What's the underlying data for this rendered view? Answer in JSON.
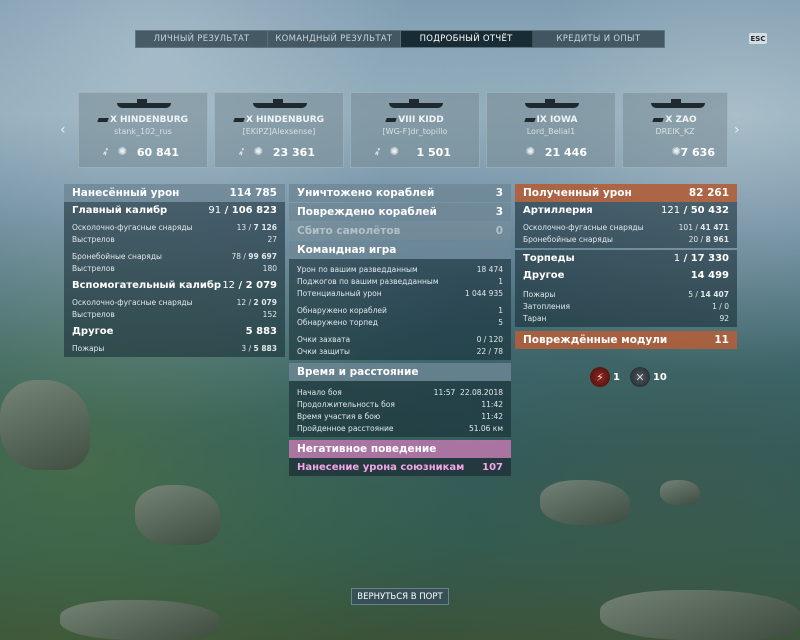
{
  "tabs": [
    "ЛИЧНЫЙ РЕЗУЛЬТАТ",
    "КОМАНДНЫЙ РЕЗУЛЬТАТ",
    "ПОДРОБНЫЙ ОТЧЁТ",
    "КРЕДИТЫ И ОПЫТ"
  ],
  "active_tab": "ПОДРОБНЫЙ ОТЧЁТ",
  "esc_label": "ESC",
  "ships": [
    {
      "name": "X HINDENBURG",
      "player": "stank_102_rus",
      "damage": "60 841"
    },
    {
      "name": "X HINDENBURG",
      "player": "[EKIPZ]Alexsense]",
      "damage": "23 361"
    },
    {
      "name": "VIII KIDD",
      "player": "[WG-F]dr_topillo",
      "damage": "1 501"
    },
    {
      "name": "IX IOWA",
      "player": "Lord_Belial1",
      "damage": "21 446"
    },
    {
      "name": "X ZAO",
      "player": "DREIK_KZ",
      "damage": "7 636"
    }
  ],
  "left": {
    "dealt": {
      "label": "Нанесённый урон",
      "value": "114 785"
    },
    "main": {
      "label": "Главный калибр",
      "hits": "91",
      "total": "106 823"
    },
    "main_rows": [
      {
        "label": "Осколочно-фугасные снаряды",
        "hits": "13",
        "total": "7 126"
      },
      {
        "label": "Выстрелов",
        "value": "27"
      },
      {
        "label": "Бронебойные снаряды",
        "hits": "78",
        "total": "99 697"
      },
      {
        "label": "Выстрелов",
        "value": "180"
      }
    ],
    "secondary": {
      "label": "Вспомогательный калибр",
      "hits": "12",
      "total": "2 079"
    },
    "secondary_rows": [
      {
        "label": "Осколочно-фугасные снаряды",
        "hits": "12",
        "total": "2 079"
      },
      {
        "label": "Выстрелов",
        "value": "152"
      }
    ],
    "other": {
      "label": "Другое",
      "value": "5 883"
    },
    "other_rows": [
      {
        "label": "Пожары",
        "hits": "3",
        "total": "5 883"
      }
    ]
  },
  "mid": {
    "destroyed": {
      "label": "Уничтожено кораблей",
      "value": "3"
    },
    "damaged": {
      "label": "Повреждено кораблей",
      "value": "3"
    },
    "planes": {
      "label": "Сбито самолётов",
      "value": "0"
    },
    "team": {
      "label": "Командная игра"
    },
    "team_rows": [
      {
        "label": "Урон по вашим разведданным",
        "value": "18 474"
      },
      {
        "label": "Поджогов по вашим разведданным",
        "value": "1"
      },
      {
        "label": "Потенциальный урон",
        "value": "1 044 935"
      },
      {
        "label": "Обнаружено кораблей",
        "value": "1"
      },
      {
        "label": "Обнаружено торпед",
        "value": "5"
      },
      {
        "label": "Очки захвата",
        "value": "0 / 120"
      },
      {
        "label": "Очки защиты",
        "value": "22 / 78"
      }
    ],
    "time": {
      "label": "Время и расстояние"
    },
    "time_rows": [
      {
        "label": "Начало боя",
        "value": "11:57  22.08.2018"
      },
      {
        "label": "Продолжительность боя",
        "value": "11:42"
      },
      {
        "label": "Время участия в бою",
        "value": "11:42"
      },
      {
        "label": "Пройденное расстояние",
        "value": "51.06 км"
      }
    ],
    "negative": {
      "label": "Негативное поведение"
    },
    "ally_damage": {
      "label": "Нанесение урона союзникам",
      "value": "107"
    }
  },
  "right": {
    "received": {
      "label": "Полученный урон",
      "value": "82 261"
    },
    "artillery": {
      "label": "Артиллерия",
      "hits": "121",
      "total": "50 432"
    },
    "artillery_rows": [
      {
        "label": "Осколочно-фугасные снаряды",
        "hits": "101",
        "total": "41 471"
      },
      {
        "label": "Бронебойные снаряды",
        "hits": "20",
        "total": "8 961"
      }
    ],
    "torpedoes": {
      "label": "Торпеды",
      "hits": "1",
      "total": "17 330"
    },
    "other": {
      "label": "Другое",
      "value": "14 499"
    },
    "other_rows": [
      {
        "label": "Пожары",
        "hits": "5",
        "total": "14 407"
      },
      {
        "label": "Затопления",
        "value": "1 / 0"
      },
      {
        "label": "Таран",
        "value": "92"
      }
    ],
    "modules": {
      "label": "Повреждённые модули",
      "value": "11"
    },
    "module_icons": [
      {
        "icon": "engine-damage-icon",
        "count": "1"
      },
      {
        "icon": "turret-damage-icon",
        "count": "10"
      }
    ]
  },
  "back_button": "ВЕРНУТЬСЯ В ПОРТ"
}
